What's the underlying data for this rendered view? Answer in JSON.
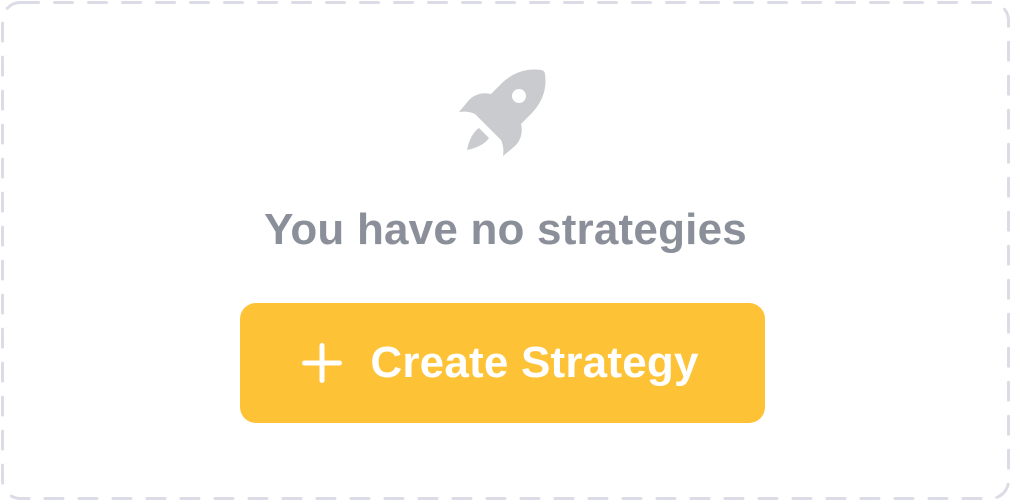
{
  "empty_state": {
    "icon": "rocket-icon",
    "message": "You have no strategies",
    "message_color": "#8b8f99",
    "icon_color": "#c9cbcf"
  },
  "create_button": {
    "icon": "plus-icon",
    "label": "Create Strategy",
    "background": "#fdc236",
    "text_color": "#ffffff"
  },
  "frame": {
    "border_style": "dashed",
    "border_color": "#dcdce6"
  }
}
